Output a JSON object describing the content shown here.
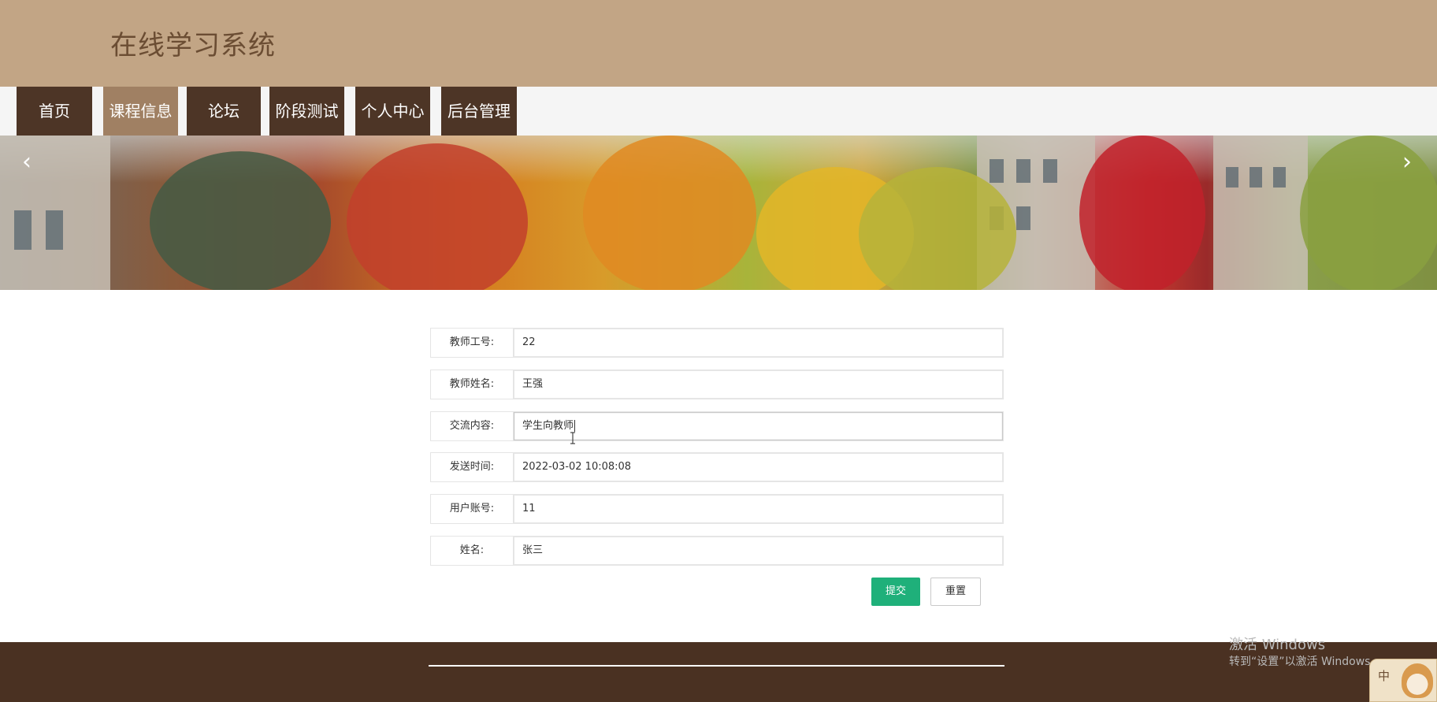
{
  "header": {
    "site_title": "在线学习系统"
  },
  "nav": {
    "items": [
      {
        "label": "首页",
        "active": false
      },
      {
        "label": "课程信息",
        "active": true
      },
      {
        "label": "论坛",
        "active": false
      },
      {
        "label": "阶段测试",
        "active": false
      },
      {
        "label": "个人中心",
        "active": false
      },
      {
        "label": "后台管理",
        "active": false
      }
    ]
  },
  "banner": {
    "prev_icon": "chevron-left-icon",
    "next_icon": "chevron-right-icon"
  },
  "form": {
    "fields": [
      {
        "label": "教师工号:",
        "value": "22"
      },
      {
        "label": "教师姓名:",
        "value": "王强"
      },
      {
        "label": "交流内容:",
        "value": "学生向教师"
      },
      {
        "label": "发送时间:",
        "value": "2022-03-02 10:08:08"
      },
      {
        "label": "用户账号:",
        "value": "11"
      },
      {
        "label": "姓名:",
        "value": "张三"
      }
    ],
    "submit_label": "提交",
    "reset_label": "重置"
  },
  "colors": {
    "header_bg": "#c2a585",
    "nav_bg": "#4d3526",
    "nav_active_bg": "#a08063",
    "submit_bg": "#1fb07a",
    "footer_bg": "#4a3122"
  },
  "watermark": {
    "line1": "激活 Windows",
    "line2": "转到“设置”以激活 Windows。"
  },
  "ime": {
    "label": "中"
  }
}
